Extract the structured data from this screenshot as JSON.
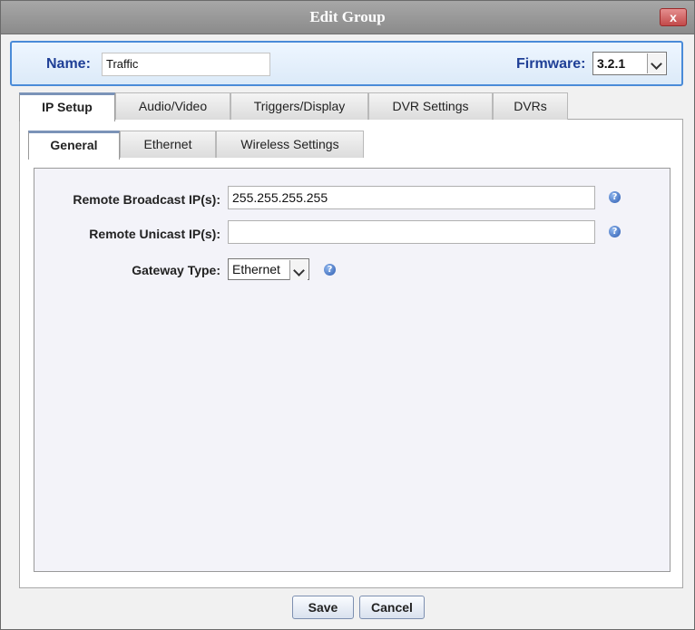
{
  "window": {
    "title": "Edit Group",
    "close_label": "x"
  },
  "header": {
    "name_label": "Name:",
    "name_value": "Traffic",
    "firmware_label": "Firmware:",
    "firmware_value": "3.2.1"
  },
  "tabs": [
    {
      "label": "IP Setup",
      "active": true
    },
    {
      "label": "Audio/Video",
      "active": false
    },
    {
      "label": "Triggers/Display",
      "active": false
    },
    {
      "label": "DVR Settings",
      "active": false
    },
    {
      "label": "DVRs",
      "active": false
    }
  ],
  "subtabs": [
    {
      "label": "General",
      "active": true
    },
    {
      "label": "Ethernet",
      "active": false
    },
    {
      "label": "Wireless Settings",
      "active": false
    }
  ],
  "form": {
    "remote_broadcast_label": "Remote Broadcast IP(s):",
    "remote_broadcast_value": "255.255.255.255",
    "remote_unicast_label": "Remote Unicast IP(s):",
    "remote_unicast_value": "",
    "gateway_type_label": "Gateway Type:",
    "gateway_type_value": "Ethernet"
  },
  "help_glyph": "?",
  "buttons": {
    "save": "Save",
    "cancel": "Cancel"
  }
}
